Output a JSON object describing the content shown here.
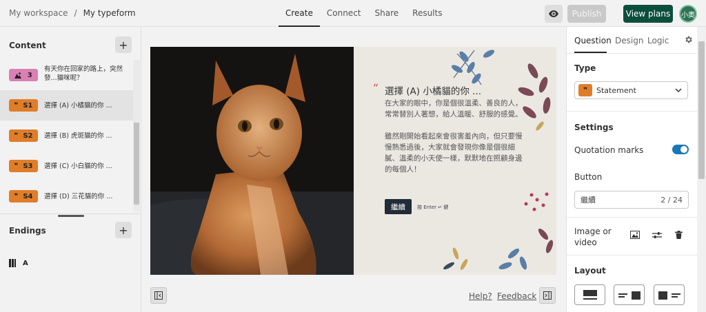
{
  "header": {
    "workspace": "My workspace",
    "separator": "/",
    "form_name": "My typeform",
    "tabs": [
      {
        "label": "Create"
      },
      {
        "label": "Connect"
      },
      {
        "label": "Share"
      },
      {
        "label": "Results"
      }
    ],
    "active_tab": "Create",
    "publish_label": "Publish",
    "view_plans_label": "View plans",
    "avatar_text": "小奧",
    "eye_icon": "eye-icon"
  },
  "sidebar": {
    "content_title": "Content",
    "endings_title": "Endings",
    "questions": [
      {
        "badge": "3",
        "type_icon": "image-icon",
        "color": "#d980b4",
        "text": "有天你在回家的路上，突然發...貓咪呢？"
      },
      {
        "badge": "S1",
        "type_icon": "quote-icon",
        "color": "#e07d29",
        "text": "選擇 (A) 小橘貓的你 ..."
      },
      {
        "badge": "S2",
        "type_icon": "quote-icon",
        "color": "#e07d29",
        "text": "選擇 (B) 虎斑貓的你 ..."
      },
      {
        "badge": "S3",
        "type_icon": "quote-icon",
        "color": "#e07d29",
        "text": "選擇 (C) 小白貓的你 ..."
      },
      {
        "badge": "S4",
        "type_icon": "quote-icon",
        "color": "#e07d29",
        "text": "選擇 (D) 三花貓的你 ..."
      }
    ],
    "ending": {
      "badge": "A",
      "type_icon": "ending-icon"
    }
  },
  "preview": {
    "title": "選擇 (A) 小橘貓的你 ...",
    "paragraph1": "在大家的眼中，你是個很溫柔、善良的人，常常替別人著想，給人溫暖、舒服的感覺。",
    "paragraph2": "雖然剛開始看起來會很害羞內向，但只要慢慢熟悉過後，大家就會發現你像是個很細膩、溫柔的小天使一樣，默默地在照顧身邊的每個人！",
    "button_label": "繼續",
    "enter_hint": "按 Enter ↵ 鍵",
    "help_label": "Help?",
    "feedback_label": "Feedback"
  },
  "panel": {
    "tabs": [
      {
        "label": "Question"
      },
      {
        "label": "Design"
      },
      {
        "label": "Logic"
      }
    ],
    "type_title": "Type",
    "type_value": "Statement",
    "settings_title": "Settings",
    "quotation_label": "Quotation marks",
    "quotation_on": true,
    "button_title": "Button",
    "button_value": "繼續",
    "button_counter": "2 / 24",
    "image_title": "Image or video",
    "layout_title": "Layout"
  },
  "colors": {
    "accent_green": "#0c4e3c",
    "toggle_blue": "#1a77b7",
    "statement_orange": "#e07d29",
    "picture_pink": "#d980b4"
  }
}
